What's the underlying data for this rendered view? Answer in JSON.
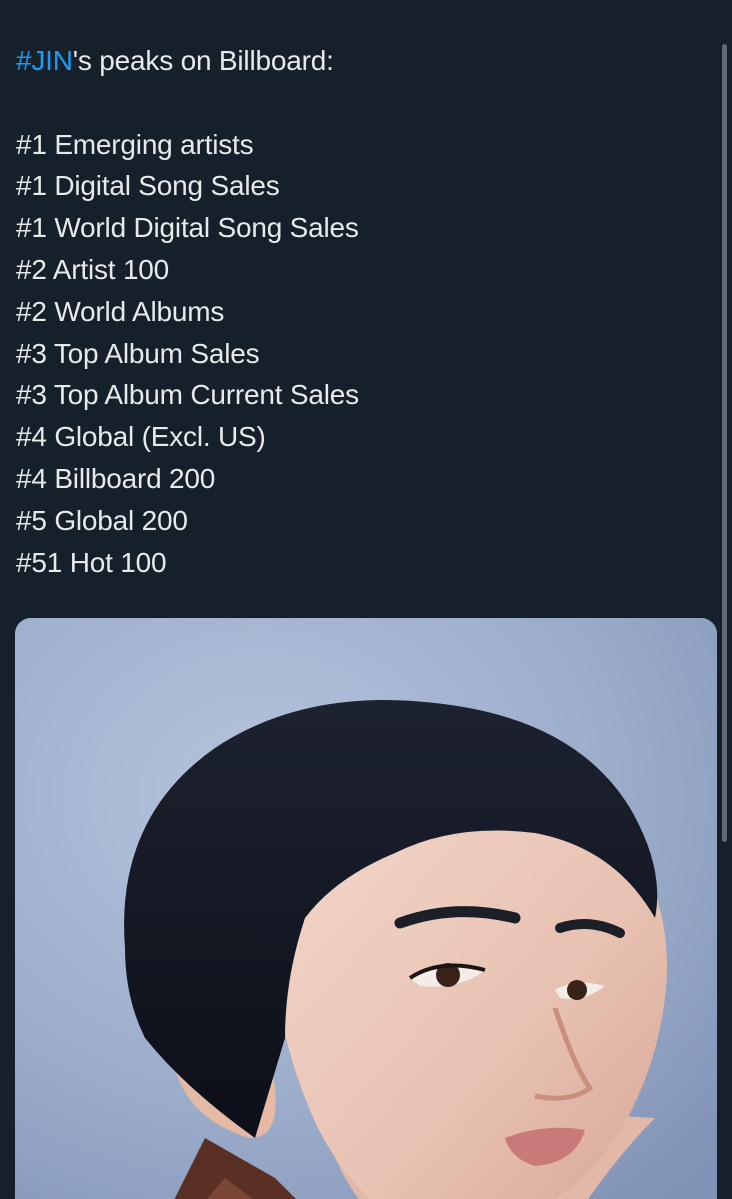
{
  "tweet": {
    "hashtag": "#JIN",
    "headline_rest": "'s peaks on Billboard:",
    "peaks": [
      "#1 Emerging artists",
      "#1 Digital Song Sales",
      "#1 World Digital Song Sales",
      "#2 Artist 100",
      "#2 World Albums",
      "#3 Top Album Sales",
      "#3 Top Album Current Sales",
      "#4 Global (Excl. US)",
      "#4 Billboard 200",
      "#5 Global 200",
      "#51 Hot 100"
    ]
  },
  "colors": {
    "background": "#15202b",
    "text": "#e7e9ea",
    "hashtag": "#1d9bf0"
  },
  "media": {
    "kind": "portrait-photo",
    "icon": "portrait-photo"
  }
}
